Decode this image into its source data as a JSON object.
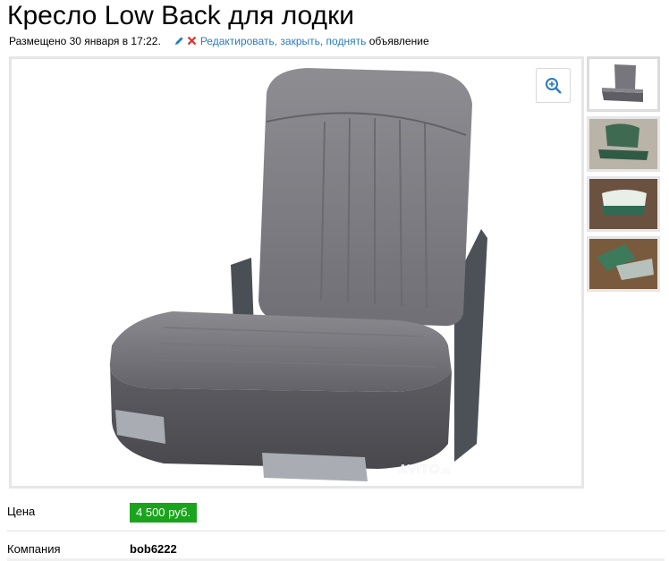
{
  "listing": {
    "title": "Кресло Low Back для лодки",
    "posted": "Размещено 30 января в 17:22.",
    "actions": {
      "edit": "Редактировать,",
      "close": "закрыть,",
      "raise": "поднять",
      "suffix": "объявление"
    },
    "photo": {
      "watermark": "AVITO",
      "watermark_suffix": ".ru",
      "zoom_icon": "zoom-in-icon",
      "thumbnail_count": 4,
      "selected_thumbnail": 1
    },
    "price": {
      "label": "Цена",
      "value": "4 500 руб."
    },
    "company": {
      "label": "Компания",
      "value": "bob6222"
    }
  },
  "colors": {
    "link": "#2a7bbd",
    "price_badge": "#1aa41c",
    "delete_icon": "#e0302b",
    "border": "#e6e6e6"
  }
}
